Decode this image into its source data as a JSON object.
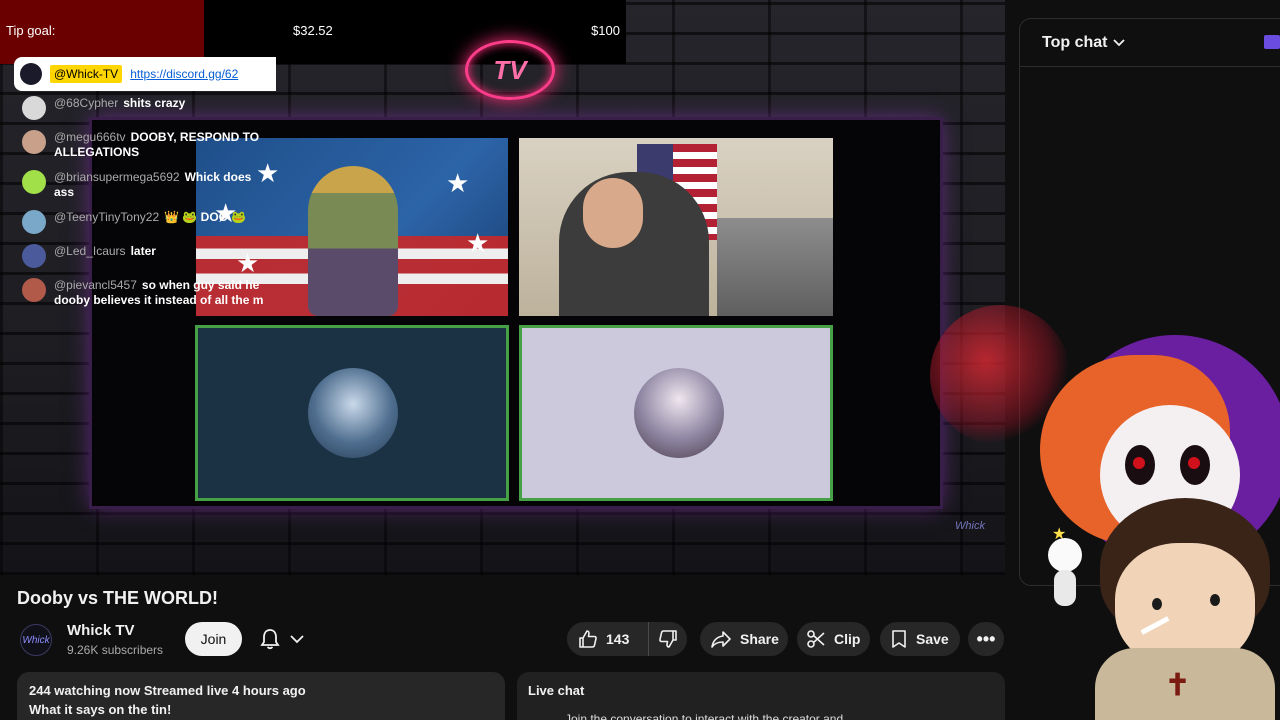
{
  "tip_goal": {
    "label": "Tip goal:",
    "current": "$32.52",
    "target": "$100",
    "progress_fraction": 0.3252,
    "fill_color": "#6b0000"
  },
  "stream_overlay": {
    "neon_logo_text": "TV",
    "watermark_text": "Whick"
  },
  "video": {
    "title": "Dooby vs THE WORLD!",
    "channel_logo_text": "Whick",
    "channel_name": "Whick TV",
    "subscribers": "9.26K subscribers",
    "join_label": "Join",
    "like_count": "143",
    "share_label": "Share",
    "clip_label": "Clip",
    "save_label": "Save",
    "more_label": "•••",
    "accent_border_color": "#46a046"
  },
  "description": {
    "meta": "244 watching now  Streamed live 4 hours ago",
    "line": "What it says on the tin!"
  },
  "live_chat_box": {
    "title": "Live chat",
    "text": "Join the conversation to interact with the creator and"
  },
  "chat": {
    "header": "Top chat",
    "pinned": {
      "tag": "@Whick-TV",
      "link": "https://discord.gg/62"
    },
    "messages": [
      {
        "author": "@68Cypher",
        "text": "shits crazy",
        "avatar_color": "#d9d9d9"
      },
      {
        "author": "@megu666tv",
        "text": "DOOBY, RESPOND TO ALLEGATIONS",
        "avatar_color": "#c9a18a"
      },
      {
        "author": "@briansupermega5692",
        "text": "Whick does ass",
        "avatar_color": "#a2e04a"
      },
      {
        "author": "@TeenyTinyTony22",
        "text": "👑 🐸 DOO 🐸",
        "avatar_color": "#7aa8c9"
      },
      {
        "author": "@Led_Icaurs",
        "text": "later",
        "avatar_color": "#4a5a9a"
      },
      {
        "author": "@pievancl5457",
        "text": "so when guy said he dooby believes it instead of all the m",
        "avatar_color": "#b25a4a"
      }
    ]
  }
}
